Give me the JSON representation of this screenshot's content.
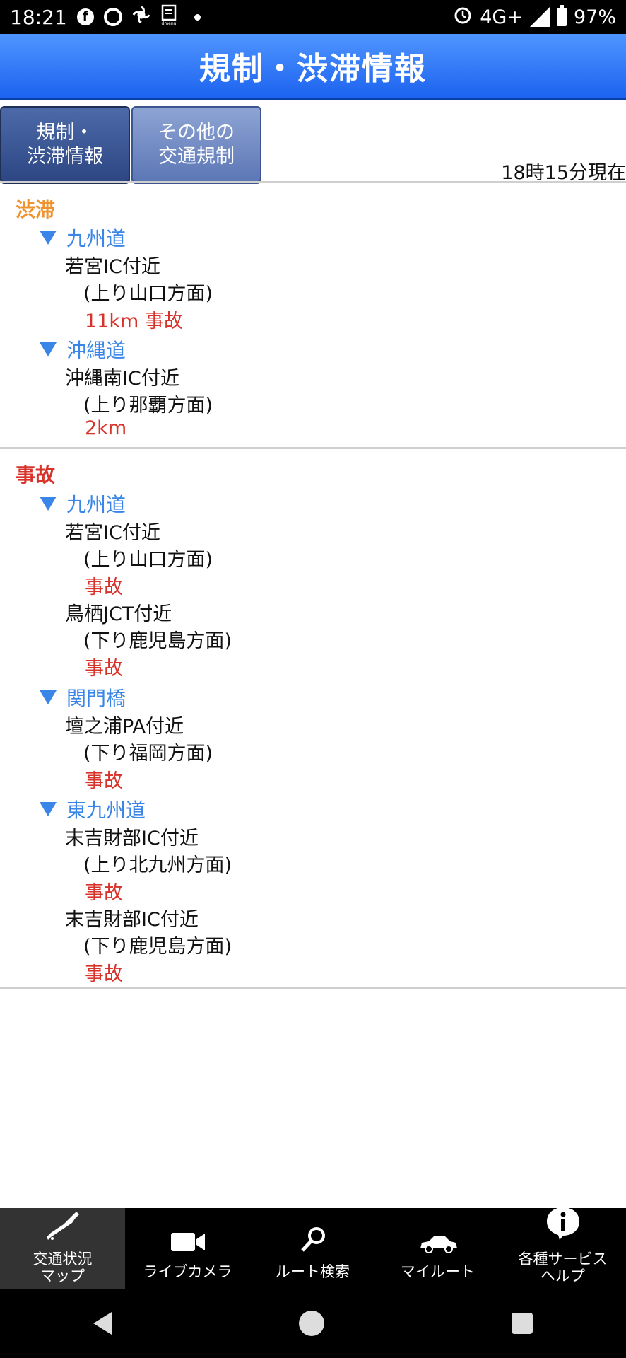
{
  "status_bar": {
    "time": "18:21",
    "network": "4G+",
    "battery": "97%",
    "icons": [
      "facebook-icon",
      "chrome-icon",
      "pinwheel-icon",
      "dmenu-icon",
      "notification-dot-icon",
      "alarm-icon",
      "signal-icon",
      "battery-icon"
    ],
    "dmenu_label": "dmenu"
  },
  "header": {
    "title": "規制・渋滞情報"
  },
  "tabs": [
    {
      "line1": "規制・",
      "line2": "渋滞情報",
      "active": true
    },
    {
      "line1": "その他の",
      "line2": "交通規制",
      "active": false
    }
  ],
  "updated": "18時15分現在",
  "sections": {
    "congestion": {
      "title": "渋滞",
      "roads": [
        {
          "name": "九州道",
          "entries": [
            {
              "location": "若宮IC付近",
              "direction": "(上り山口方面)",
              "info": "11km 事故"
            }
          ]
        },
        {
          "name": "沖縄道",
          "entries": [
            {
              "location": "沖縄南IC付近",
              "direction": "(上り那覇方面)",
              "info": "2km"
            }
          ]
        }
      ]
    },
    "accident": {
      "title": "事故",
      "roads": [
        {
          "name": "九州道",
          "entries": [
            {
              "location": "若宮IC付近",
              "direction": "(上り山口方面)",
              "info": "事故"
            },
            {
              "location": "鳥栖JCT付近",
              "direction": "(下り鹿児島方面)",
              "info": "事故"
            }
          ]
        },
        {
          "name": "関門橋",
          "entries": [
            {
              "location": "壇之浦PA付近",
              "direction": "(下り福岡方面)",
              "info": "事故"
            }
          ]
        },
        {
          "name": "東九州道",
          "entries": [
            {
              "location": "末吉財部IC付近",
              "direction": "(上り北九州方面)",
              "info": "事故"
            },
            {
              "location": "末吉財部IC付近",
              "direction": "(下り鹿児島方面)",
              "info": "事故"
            }
          ]
        }
      ]
    }
  },
  "bottom_nav": [
    {
      "line1": "交通状況",
      "line2": "マップ",
      "icon": "japan-map-icon",
      "active": true
    },
    {
      "line1": "ライブカメラ",
      "line2": "",
      "icon": "video-camera-icon",
      "active": false
    },
    {
      "line1": "ルート検索",
      "line2": "",
      "icon": "magnifier-icon",
      "active": false
    },
    {
      "line1": "マイルート",
      "line2": "",
      "icon": "car-icon",
      "active": false
    },
    {
      "line1": "各種サービス",
      "line2": "ヘルプ",
      "icon": "info-icon",
      "active": false
    }
  ],
  "system_nav": [
    "back-icon",
    "home-icon",
    "recents-icon"
  ],
  "colors": {
    "header_blue": "#2f78f7",
    "congestion_orange": "#ee9330",
    "accident_red": "#d8332b",
    "road_blue": "#3a86e8"
  }
}
